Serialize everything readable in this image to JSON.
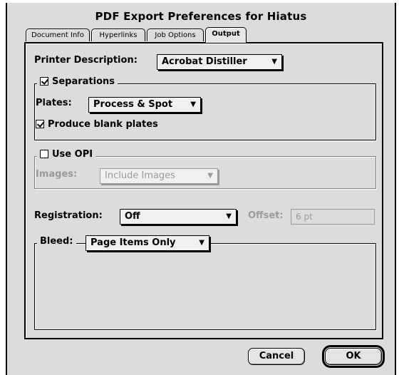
{
  "window": {
    "title": "PDF Export Preferences for Hiatus"
  },
  "tabs": [
    {
      "label": "Document Info",
      "active": false
    },
    {
      "label": "Hyperlinks",
      "active": false
    },
    {
      "label": "Job Options",
      "active": false
    },
    {
      "label": "Output",
      "active": true
    }
  ],
  "printer": {
    "label": "Printer Description:",
    "value": "Acrobat Distiller"
  },
  "separations": {
    "label": "Separations",
    "checked": true,
    "plates_label": "Plates:",
    "plates_value": "Process & Spot",
    "blank_plates_label": "Produce blank plates",
    "blank_plates_checked": true
  },
  "opi": {
    "label": "Use OPI",
    "checked": false,
    "images_label": "Images:",
    "images_value": "Include Images"
  },
  "registration": {
    "label": "Registration:",
    "value": "Off",
    "offset_label": "Offset:",
    "offset_value": "6 pt"
  },
  "bleed": {
    "label": "Bleed:",
    "value": "Page Items Only"
  },
  "buttons": {
    "cancel": "Cancel",
    "ok": "OK"
  },
  "icons": {
    "dropdown": "triangle-down-icon",
    "check": "checkmark-icon"
  }
}
